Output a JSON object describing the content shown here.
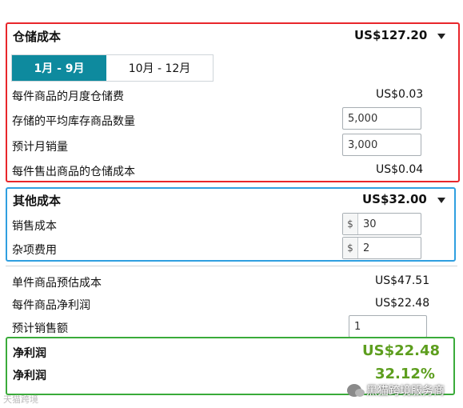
{
  "storage": {
    "title": "仓储成本",
    "total": "US$127.20",
    "tabs": [
      "1月 - 9月",
      "10月 - 12月"
    ],
    "rows": [
      {
        "label": "每件商品的月度仓储费",
        "value": "US$0.03"
      },
      {
        "label": "存储的平均库存商品数量",
        "input": "5,000"
      },
      {
        "label": "预计月销量",
        "input": "3,000"
      },
      {
        "label": "每件售出商品的仓储成本",
        "value": "US$0.04"
      }
    ]
  },
  "other": {
    "title": "其他成本",
    "total": "US$32.00",
    "rows": [
      {
        "label": "销售成本",
        "prefix": "$",
        "input": "30"
      },
      {
        "label": "杂项费用",
        "prefix": "$",
        "input": "2"
      }
    ]
  },
  "summary": {
    "rows": [
      {
        "label": "单件商品预估成本",
        "value": "US$47.51"
      },
      {
        "label": "每件商品净利润",
        "value": "US$22.48"
      },
      {
        "label": "预计销售额",
        "input": "1"
      }
    ]
  },
  "profit": {
    "label1": "净利润",
    "value1": "US$22.48",
    "label2": "净利润",
    "value2": "32.12%"
  },
  "watermarks": {
    "left": "天猫跨境",
    "right": "黑猫跨境服务商"
  },
  "colors": {
    "accent_tab": "#0e8a9e",
    "profit_green": "#5d9e1e",
    "storage_box": "#e8262b",
    "other_box": "#2f9fe0",
    "profit_box": "#3aab3a"
  },
  "icons": {
    "collapse": "chevron-down-icon",
    "watermark": "wechat-icon"
  }
}
